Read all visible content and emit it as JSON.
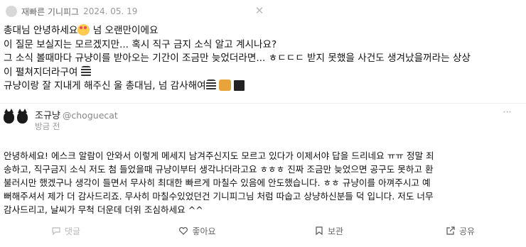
{
  "question_meta": {
    "asker_name": "재빠른 기니피그",
    "date": "2024. 05. 19",
    "close_icon": "close-icon"
  },
  "question": {
    "line1_a": "총대님 안녕하세요",
    "line1_b": " 넘 오랜만이에요",
    "line2": "이 질문 보실지는 모르겠지만... 혹시 직구 금지 소식 알고 계시나요?",
    "line3": "그 소식 볼때마다 규냥이를 받아오는 기간이 조금만 늦었더라면... ㅎㄷㄷㄷ 받지 못했을 사건도 생겨났을꺼라는 상상",
    "line4": "이 펼쳐지더라구여",
    "line5": "규냥이랑 잘 지내게 해주신 울 총대님, 넘 감사해여"
  },
  "author": {
    "name": "조규냥",
    "handle": "@choguecat",
    "time": "방금 전",
    "more_icon": "more-icon"
  },
  "answer": {
    "lines": [
      "안녕하세요! 에스크 알람이 안와서 이렇게 메세지 남겨주신지도 모르고 있다가 이제서야 답을 드리네요 ㅠㅠ 정말 죄",
      "송하고, 직구금지 소식 저도 첨 들었을때 규냥이부터 생각나더라고요 ㅎㅎㅎ 진짜 조금만 늦었으면 공구도 못하고 환",
      "불러시만 했겠구나 생각이 들면서 무사히 최대한 빠르게 마칠수 있음에 안도했습니다. ㅎㅎ 규냥이를 아껴주시고 예",
      "뻐해주셔서 제가 더 감사드리죠. 무사히 마칠수있었던건 기니피그님 처럼 따숩고 상냥하신분들 덕 입니다. 저도 너무",
      "감사드리고, 날씨가 무척 더운데 더위 조심하세요 ^^"
    ]
  },
  "actions": {
    "comment": "댓글",
    "like": "좋아요",
    "save": "보관",
    "share": "공유"
  }
}
